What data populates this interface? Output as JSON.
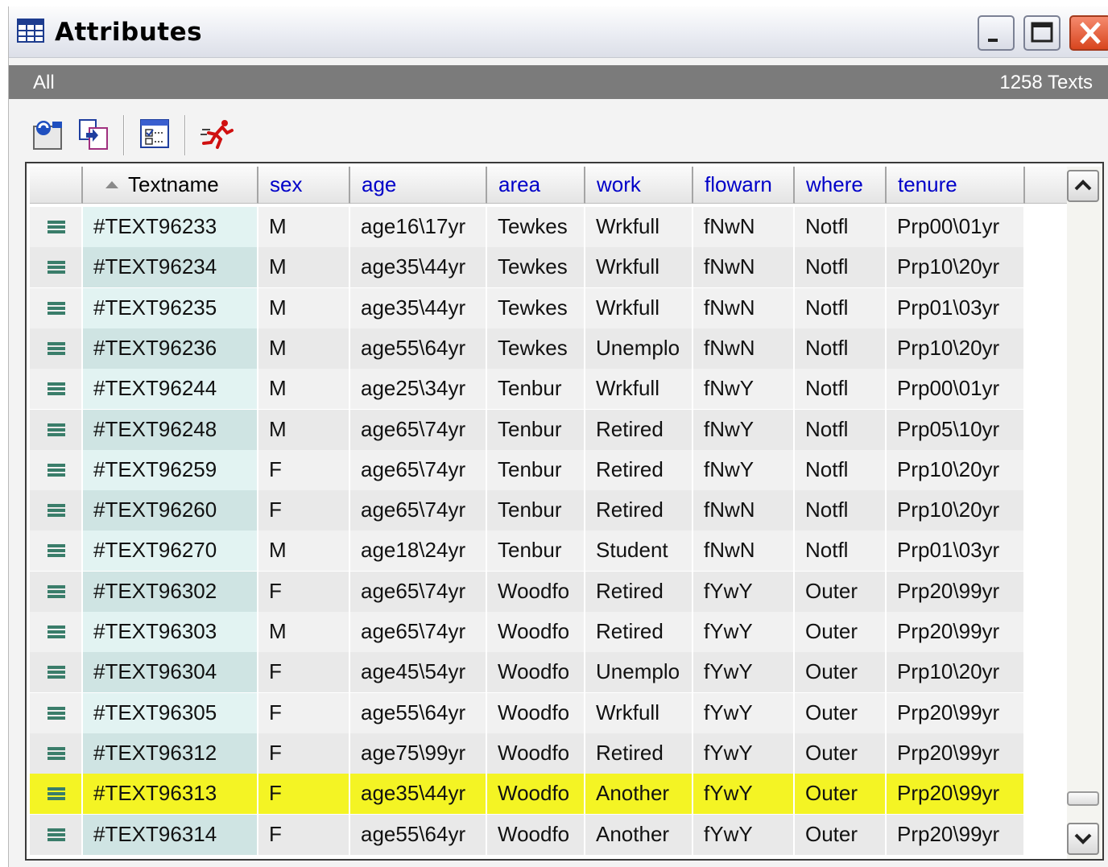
{
  "window": {
    "title": "Attributes",
    "controls": [
      "minimize",
      "maximize",
      "close"
    ]
  },
  "status": {
    "filter": "All",
    "count": "1258 Texts"
  },
  "toolbar": {
    "icons": [
      "refresh-icon",
      "copy-icon",
      "checklist-icon",
      "runner-icon"
    ]
  },
  "table": {
    "columns": [
      "Textname",
      "sex",
      "age",
      "area",
      "work",
      "flowarn",
      "where",
      "tenure"
    ],
    "sorted_column": "Textname",
    "rows": [
      [
        "#TEXT96233",
        "M",
        "age16\\17yr",
        "Tewkes",
        "Wrkfull",
        "fNwN",
        "Notfl",
        "Prp00\\01yr"
      ],
      [
        "#TEXT96234",
        "M",
        "age35\\44yr",
        "Tewkes",
        "Wrkfull",
        "fNwN",
        "Notfl",
        "Prp10\\20yr"
      ],
      [
        "#TEXT96235",
        "M",
        "age35\\44yr",
        "Tewkes",
        "Wrkfull",
        "fNwN",
        "Notfl",
        "Prp01\\03yr"
      ],
      [
        "#TEXT96236",
        "M",
        "age55\\64yr",
        "Tewkes",
        "Unemplo",
        "fNwN",
        "Notfl",
        "Prp10\\20yr"
      ],
      [
        "#TEXT96244",
        "M",
        "age25\\34yr",
        "Tenbur",
        "Wrkfull",
        "fNwY",
        "Notfl",
        "Prp00\\01yr"
      ],
      [
        "#TEXT96248",
        "M",
        "age65\\74yr",
        "Tenbur",
        "Retired",
        "fNwY",
        "Notfl",
        "Prp05\\10yr"
      ],
      [
        "#TEXT96259",
        "F",
        "age65\\74yr",
        "Tenbur",
        "Retired",
        "fNwY",
        "Notfl",
        "Prp10\\20yr"
      ],
      [
        "#TEXT96260",
        "F",
        "age65\\74yr",
        "Tenbur",
        "Retired",
        "fNwN",
        "Notfl",
        "Prp10\\20yr"
      ],
      [
        "#TEXT96270",
        "M",
        "age18\\24yr",
        "Tenbur",
        "Student",
        "fNwN",
        "Notfl",
        "Prp01\\03yr"
      ],
      [
        "#TEXT96302",
        "F",
        "age65\\74yr",
        "Woodfo",
        "Retired",
        "fYwY",
        "Outer",
        "Prp20\\99yr"
      ],
      [
        "#TEXT96303",
        "M",
        "age65\\74yr",
        "Woodfo",
        "Retired",
        "fYwY",
        "Outer",
        "Prp20\\99yr"
      ],
      [
        "#TEXT96304",
        "F",
        "age45\\54yr",
        "Woodfo",
        "Unemplo",
        "fYwY",
        "Outer",
        "Prp10\\20yr"
      ],
      [
        "#TEXT96305",
        "F",
        "age55\\64yr",
        "Woodfo",
        "Wrkfull",
        "fYwY",
        "Outer",
        "Prp20\\99yr"
      ],
      [
        "#TEXT96312",
        "F",
        "age75\\99yr",
        "Woodfo",
        "Retired",
        "fYwY",
        "Outer",
        "Prp20\\99yr"
      ],
      [
        "#TEXT96313",
        "F",
        "age35\\44yr",
        "Woodfo",
        "Another",
        "fYwY",
        "Outer",
        "Prp20\\99yr"
      ],
      [
        "#TEXT96314",
        "F",
        "age55\\64yr",
        "Woodfo",
        "Another",
        "fYwY",
        "Outer",
        "Prp20\\99yr"
      ]
    ],
    "selected_row_index": 14,
    "selected_color": "#f4f424"
  }
}
